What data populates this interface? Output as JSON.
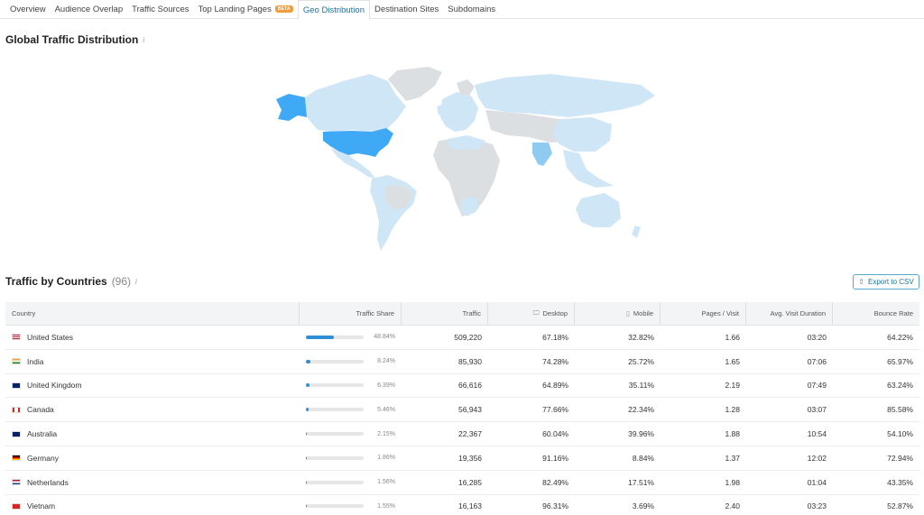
{
  "tabs": [
    {
      "label": "Overview"
    },
    {
      "label": "Audience Overlap"
    },
    {
      "label": "Traffic Sources"
    },
    {
      "label": "Top Landing Pages",
      "badge": "BETA"
    },
    {
      "label": "Geo Distribution",
      "active": true
    },
    {
      "label": "Destination Sites"
    },
    {
      "label": "Subdomains"
    }
  ],
  "geo": {
    "title": "Global Traffic Distribution",
    "info_icon": "info-icon"
  },
  "countries_section": {
    "title": "Traffic by Countries",
    "count": "(96)",
    "info_icon": "info-icon",
    "export_label": "Export to CSV",
    "export_icon": "export-icon"
  },
  "table": {
    "headers": {
      "country": "Country",
      "share": "Traffic Share",
      "traffic": "Traffic",
      "desktop": "Desktop",
      "mobile": "Mobile",
      "pages": "Pages / Visit",
      "duration": "Avg. Visit Duration",
      "bounce": "Bounce Rate"
    },
    "rows": [
      {
        "country": "United States",
        "flag": "us",
        "share": "48.84%",
        "share_value": 48.84,
        "traffic": "509,220",
        "desktop": "67.18%",
        "mobile": "32.82%",
        "pages": "1.66",
        "duration": "03:20",
        "bounce": "64.22%"
      },
      {
        "country": "India",
        "flag": "in",
        "share": "8.24%",
        "share_value": 8.24,
        "traffic": "85,930",
        "desktop": "74.28%",
        "mobile": "25.72%",
        "pages": "1.65",
        "duration": "07:06",
        "bounce": "65.97%"
      },
      {
        "country": "United Kingdom",
        "flag": "gb",
        "share": "6.39%",
        "share_value": 6.39,
        "traffic": "66,616",
        "desktop": "64.89%",
        "mobile": "35.11%",
        "pages": "2.19",
        "duration": "07:49",
        "bounce": "63.24%"
      },
      {
        "country": "Canada",
        "flag": "ca",
        "share": "5.46%",
        "share_value": 5.46,
        "traffic": "56,943",
        "desktop": "77.66%",
        "mobile": "22.34%",
        "pages": "1.28",
        "duration": "03:07",
        "bounce": "85.58%"
      },
      {
        "country": "Australia",
        "flag": "au",
        "share": "2.15%",
        "share_value": 2.15,
        "traffic": "22,367",
        "desktop": "60.04%",
        "mobile": "39.96%",
        "pages": "1.88",
        "duration": "10:54",
        "bounce": "54.10%"
      },
      {
        "country": "Germany",
        "flag": "de",
        "share": "1.86%",
        "share_value": 1.86,
        "traffic": "19,356",
        "desktop": "91.16%",
        "mobile": "8.84%",
        "pages": "1.37",
        "duration": "12:02",
        "bounce": "72.94%"
      },
      {
        "country": "Netherlands",
        "flag": "nl",
        "share": "1.56%",
        "share_value": 1.56,
        "traffic": "16,285",
        "desktop": "82.49%",
        "mobile": "17.51%",
        "pages": "1.98",
        "duration": "01:04",
        "bounce": "43.35%"
      },
      {
        "country": "Vietnam",
        "flag": "vn",
        "share": "1.55%",
        "share_value": 1.55,
        "traffic": "16,163",
        "desktop": "96.31%",
        "mobile": "3.69%",
        "pages": "2.40",
        "duration": "03:23",
        "bounce": "52.87%"
      }
    ]
  },
  "colors": {
    "accent": "#1a73a8",
    "bar": "#2e8fd6",
    "map_highlight": "#3fa9f5",
    "map_light": "#cfe6f7",
    "map_none": "#dcdfe2"
  }
}
